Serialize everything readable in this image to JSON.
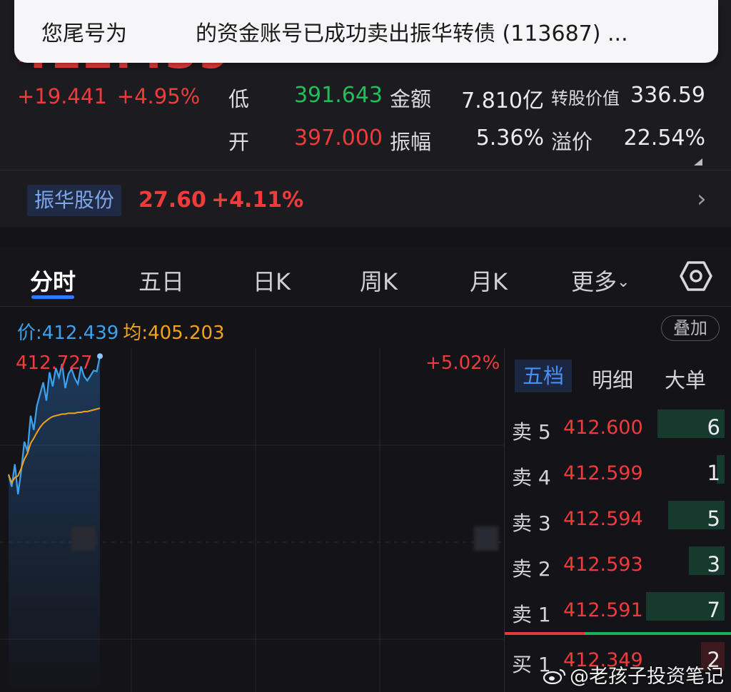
{
  "notification": {
    "prefix": "您尾号为",
    "suffix": "的资金账号已成功卖出振华转债 (113687) ..."
  },
  "quote": {
    "price": "412.439",
    "change": "+19.441",
    "change_pct": "+4.95%",
    "stats": [
      {
        "label": "低",
        "value": "391.643",
        "color": "#1fbf5c"
      },
      {
        "label": "金额",
        "value": "7.810亿",
        "color": "#ececf0"
      },
      {
        "label": "转股价值",
        "value": "336.59",
        "color": "#ececf0"
      },
      {
        "label": "开",
        "value": "397.000",
        "color": "#ef3b3b"
      },
      {
        "label": "振幅",
        "value": "5.36%",
        "color": "#ececf0"
      },
      {
        "label": "溢价",
        "value": "22.54%",
        "color": "#ececf0"
      }
    ]
  },
  "underlying": {
    "name": "振华股份",
    "price": "27.60",
    "change_pct": "+4.11%"
  },
  "tabs": [
    {
      "label": "分时",
      "active": true
    },
    {
      "label": "五日"
    },
    {
      "label": "日K"
    },
    {
      "label": "周K"
    },
    {
      "label": "月K"
    },
    {
      "label": "更多"
    }
  ],
  "more_chevron": "chevron-down-icon",
  "settings_icon": "hexagon-settings-icon",
  "price_line": {
    "price_label": "价:",
    "price_value": "412.439",
    "avg_label": "均:",
    "avg_value": "405.203",
    "overlay_button": "叠加"
  },
  "chart_labels": {
    "high": "412.727",
    "high_pct": "+5.02%"
  },
  "chart_data": {
    "type": "line",
    "ylim": [
      391.5,
      413.0
    ],
    "series": [
      {
        "values": [
          398.6,
          397.1,
          399.8,
          396.2,
          399.0,
          402.5,
          401.3,
          405.6,
          403.9,
          406.8,
          408.2,
          409.6,
          407.4,
          410.8,
          409.1,
          411.3,
          410.2,
          411.8,
          408.9,
          410.6,
          411.2,
          410.1,
          409.4,
          411.5,
          410.3,
          409.8,
          410.4,
          411.0,
          410.9,
          412.727
        ]
      },
      {
        "values": [
          398.5,
          397.6,
          398.2,
          398.4,
          399.3,
          400.4,
          401.1,
          402.3,
          402.9,
          403.6,
          404.2,
          404.7,
          405.0,
          405.3,
          405.5,
          405.6,
          405.7,
          405.8,
          405.8,
          405.9,
          405.9,
          405.9,
          406.0,
          406.0,
          406.1,
          406.1,
          406.2,
          406.3,
          406.4,
          406.5
        ]
      }
    ]
  },
  "order_book": {
    "tabs": [
      "五档",
      "明细",
      "大单"
    ],
    "asks": [
      {
        "label": "卖 5",
        "price": "412.600",
        "volume": "6",
        "ratio": 0.85
      },
      {
        "label": "卖 4",
        "price": "412.599",
        "volume": "1",
        "ratio": 0.1
      },
      {
        "label": "卖 3",
        "price": "412.594",
        "volume": "5",
        "ratio": 0.72
      },
      {
        "label": "卖 2",
        "price": "412.593",
        "volume": "3",
        "ratio": 0.45
      },
      {
        "label": "卖 1",
        "price": "412.591",
        "volume": "7",
        "ratio": 1.0
      }
    ],
    "bids": [
      {
        "label": "买 1",
        "price": "412.349",
        "volume": "2",
        "ratio": 0.3
      }
    ]
  },
  "watermark": "@老孩子投资笔记"
}
